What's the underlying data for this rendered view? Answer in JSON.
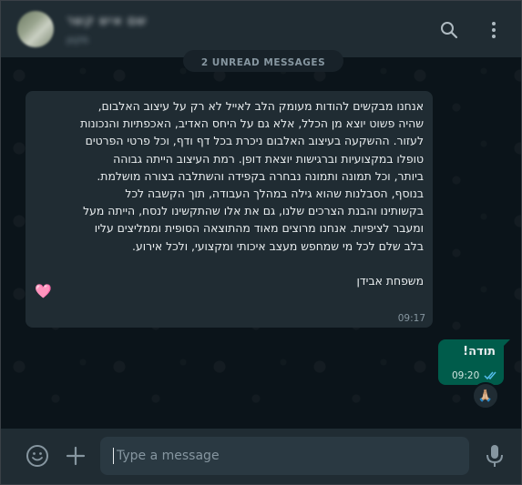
{
  "header": {
    "contact_name": "שם איש קשר",
    "contact_status": "מקוון",
    "icons": [
      "search-icon",
      "menu-icon"
    ]
  },
  "chat": {
    "unread_label": "2 UNREAD MESSAGES",
    "incoming": {
      "text": "אנחנו מבקשים להודות מעומק הלב לאייל לא רק על עיצוב האלבום,\nשהיה פשוט יוצא מן הכלל, אלא גם על היחס האדיב, האכפתיות והנכונות\nלעזור. ההשקעה בעיצוב האלבום ניכרת בכל דף ודף, וכל פרטי הפרטים\nטופלו במקצועיות וברגישות יוצאת דופן. רמת העיצוב הייתה גבוהה\nביותר, וכל תמונה ותמונה נבחרה בקפידה והשתלבה בצורה מושלמת.\nבנוסף, הסבלנות שהוא גילה במהלך העבודה, תוך הקשבה לכל\nבקשותינו והבנת הצרכים שלנו, גם את אלו שהתקשינו לנסח, הייתה מעל\nומעבר לציפיות. אנחנו מרוצים מאוד מהתוצאה הסופית וממליצים עליו\nבלב שלם לכל מי שמחפש מעצב איכותי ומקצועי, ולכל אירוע.\n\nמשפחת אבידן",
      "emoji": "🩷",
      "time": "09:17"
    },
    "outgoing": {
      "text": "תודה!",
      "time": "09:20",
      "status_icon": "double-check-icon",
      "reaction": "🙏🏼"
    }
  },
  "composer": {
    "placeholder": "Type a message",
    "icons": [
      "emoji-icon",
      "plus-icon",
      "mic-icon"
    ]
  },
  "colors": {
    "header_bg": "#202c33",
    "chat_bg": "#0b141a",
    "incoming_bubble": "#202c33",
    "outgoing_bubble": "#005c4b",
    "read_ticks": "#53bdeb"
  }
}
